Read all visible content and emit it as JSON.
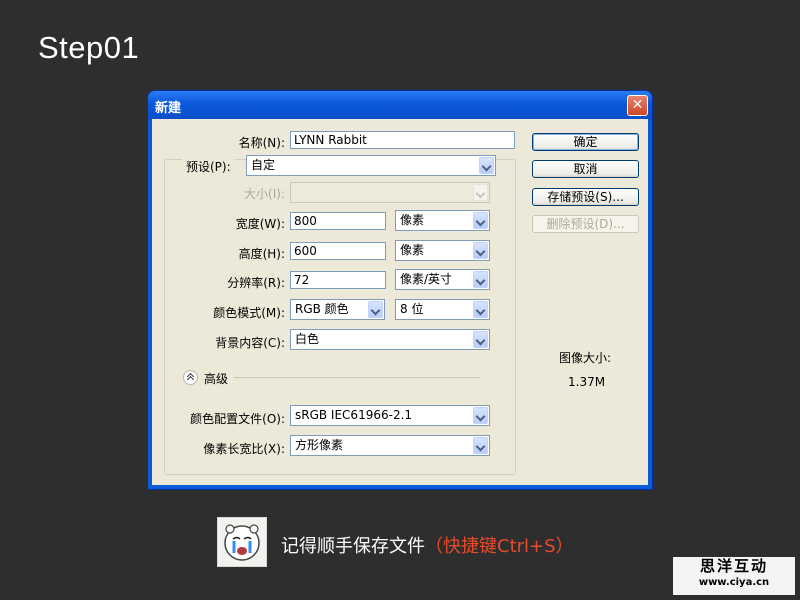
{
  "step_title": "Step01",
  "dialog": {
    "title": "新建",
    "close_glyph": "✕",
    "name_label": "名称(N):",
    "name_value": "LYNN Rabbit",
    "preset_label": "预设(P):",
    "preset_value": "自定",
    "size_label": "大小(I):",
    "size_value": "",
    "width_label": "宽度(W):",
    "width_value": "800",
    "width_unit": "像素",
    "height_label": "高度(H):",
    "height_value": "600",
    "height_unit": "像素",
    "resolution_label": "分辨率(R):",
    "resolution_value": "72",
    "resolution_unit": "像素/英寸",
    "color_mode_label": "颜色模式(M):",
    "color_mode_value": "RGB 颜色",
    "bit_depth_value": "8 位",
    "background_label": "背景内容(C):",
    "background_value": "白色",
    "advanced_label": "高级",
    "color_profile_label": "颜色配置文件(O):",
    "color_profile_value": "sRGB IEC61966-2.1",
    "pixel_aspect_label": "像素长宽比(X):",
    "pixel_aspect_value": "方形像素",
    "buttons": {
      "ok": "确定",
      "cancel": "取消",
      "save_preset": "存储预设(S)...",
      "delete_preset": "删除预设(D)..."
    },
    "image_size_label": "图像大小:",
    "image_size_value": "1.37M"
  },
  "tip": {
    "text": "记得顺手保存文件",
    "shortcut": "（快捷键Ctrl+S）"
  },
  "logo": {
    "line1": "思洋互动",
    "line2": "www.ciya.cn"
  },
  "colors": {
    "background": "#2e2e2e",
    "titlebar": "#0b58dc",
    "dialog_body": "#ece9d8",
    "accent": "#e84a2c"
  }
}
